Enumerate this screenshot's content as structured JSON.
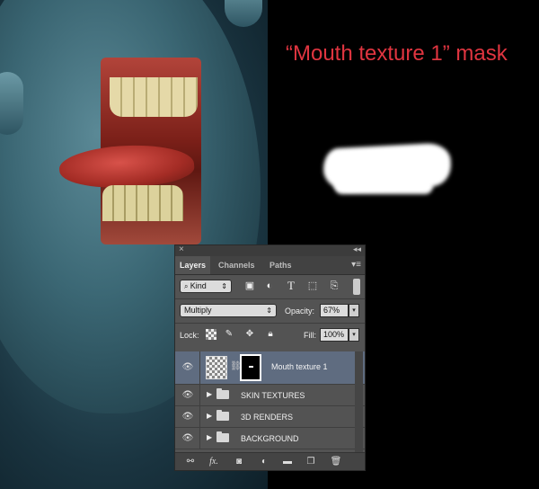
{
  "artwork": {
    "mask_caption": "“Mouth texture 1” mask"
  },
  "panel": {
    "tabs": [
      "Layers",
      "Channels",
      "Paths"
    ],
    "filter": {
      "kind": "Kind"
    },
    "blend_mode": "Multiply",
    "opacity_label": "Opacity:",
    "opacity_value": "67%",
    "lock_label": "Lock:",
    "fill_label": "Fill:",
    "fill_value": "100%",
    "layers": [
      {
        "name": "Mouth texture 1",
        "type": "layer",
        "selected": true
      },
      {
        "name": "SKIN TEXTURES",
        "type": "group"
      },
      {
        "name": "3D RENDERS",
        "type": "group"
      },
      {
        "name": "BACKGROUND",
        "type": "group"
      }
    ],
    "footer_icons": [
      "link-icon",
      "fx-icon",
      "add-mask-icon",
      "adjustment-icon",
      "new-group-icon",
      "new-layer-icon",
      "trash-icon"
    ],
    "fx_label": "fx.",
    "accent_selected": "#5f6c80"
  }
}
